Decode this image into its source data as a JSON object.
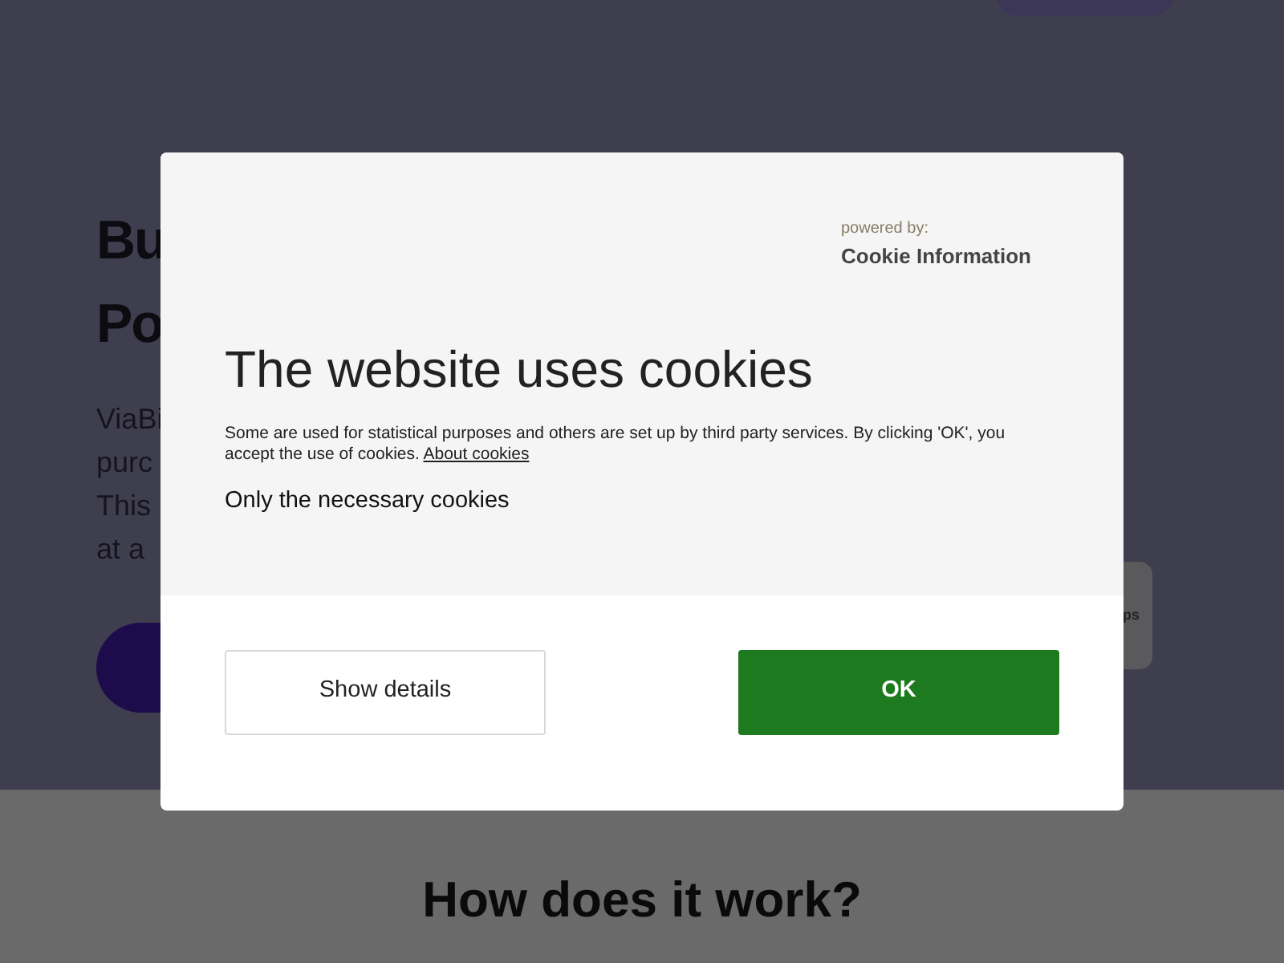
{
  "page": {
    "heading_lines": [
      "Bu",
      "Po"
    ],
    "paragraph_lines": [
      "ViaBi",
      "purc",
      "This",
      "at a"
    ],
    "side_card_text": "ps",
    "section_title": "How does it work?"
  },
  "dialog": {
    "powered_by": "powered by:",
    "brand": "Cookie Information",
    "title": "The website uses cookies",
    "body": "Some are used for statistical purposes and others are set up by third party services. By clicking 'OK', you accept the use of cookies.",
    "about_link": "About cookies",
    "necessary_option": "Only the necessary cookies",
    "buttons": [
      {
        "kind": "secondary",
        "label": "Show details"
      },
      {
        "kind": "primary",
        "label": "OK"
      }
    ]
  }
}
